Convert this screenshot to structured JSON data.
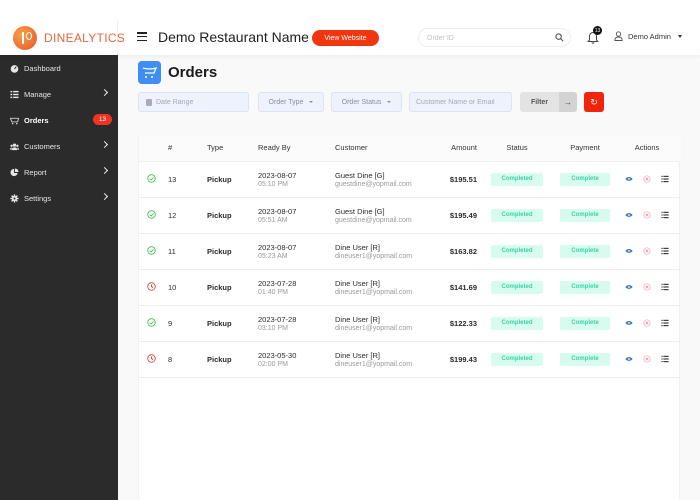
{
  "brand": {
    "name": "DINEALYTICS",
    "accent": "#f0350f"
  },
  "header": {
    "restaurant_name": "Demo Restaurant Name",
    "view_website_label": "View Website",
    "search_placeholder": "Order ID",
    "notification_count": "13",
    "user_name": "Demo Admin"
  },
  "sidebar": {
    "items": [
      {
        "label": "Dashboard",
        "icon": "dashboard-icon"
      },
      {
        "label": "Manage",
        "icon": "list-icon"
      },
      {
        "label": "Orders",
        "icon": "cart-icon",
        "badge": "13"
      },
      {
        "label": "Customers",
        "icon": "users-icon"
      },
      {
        "label": "Report",
        "icon": "pie-chart-icon"
      },
      {
        "label": "Settings",
        "icon": "gear-icon"
      }
    ]
  },
  "page": {
    "title": "Orders",
    "filters": {
      "date_range_placeholder": "Date Range",
      "order_type_label": "Order Type",
      "order_status_label": "Order Status",
      "customer_placeholder": "Customer Name or Email",
      "filter_label": "Filter",
      "filter_arrow": "→",
      "reset_icon": "↻"
    }
  },
  "table": {
    "columns": [
      "",
      "#",
      "Type",
      "Ready By",
      "Customer",
      "Amount",
      "Status",
      "Payment",
      "Actions"
    ],
    "rows": [
      {
        "state": "done",
        "num": "13",
        "type": "Pickup",
        "date": "2023-08-07",
        "time": "05:10 PM",
        "customer": "Guest Dine [G]",
        "email": "guestdine@yopmail.com",
        "amount": "$195.51",
        "status": "Completed",
        "payment": "Complete"
      },
      {
        "state": "done",
        "num": "12",
        "type": "Pickup",
        "date": "2023-08-07",
        "time": "05:51 AM",
        "customer": "Guest Dine [G]",
        "email": "guestdine@yopmail.com",
        "amount": "$195.49",
        "status": "Completed",
        "payment": "Complete"
      },
      {
        "state": "done",
        "num": "11",
        "type": "Pickup",
        "date": "2023-08-07",
        "time": "05:23 AM",
        "customer": "Dine User [R]",
        "email": "dineuser1@yopmail.com",
        "amount": "$163.82",
        "status": "Completed",
        "payment": "Complete"
      },
      {
        "state": "late",
        "num": "10",
        "type": "Pickup",
        "date": "2023-07-28",
        "time": "01:40 PM",
        "customer": "Dine User [R]",
        "email": "dineuser1@yopmail.com",
        "amount": "$141.69",
        "status": "Completed",
        "payment": "Complete"
      },
      {
        "state": "done",
        "num": "9",
        "type": "Pickup",
        "date": "2023-07-28",
        "time": "03:10 PM",
        "customer": "Dine User [R]",
        "email": "dineuser1@yopmail.com",
        "amount": "$122.33",
        "status": "Completed",
        "payment": "Complete"
      },
      {
        "state": "late",
        "num": "8",
        "type": "Pickup",
        "date": "2023-05-30",
        "time": "02:00 PM",
        "customer": "Dine User [R]",
        "email": "dineuser1@yopmail.com",
        "amount": "$199.43",
        "status": "Completed",
        "payment": "Complete"
      }
    ]
  }
}
